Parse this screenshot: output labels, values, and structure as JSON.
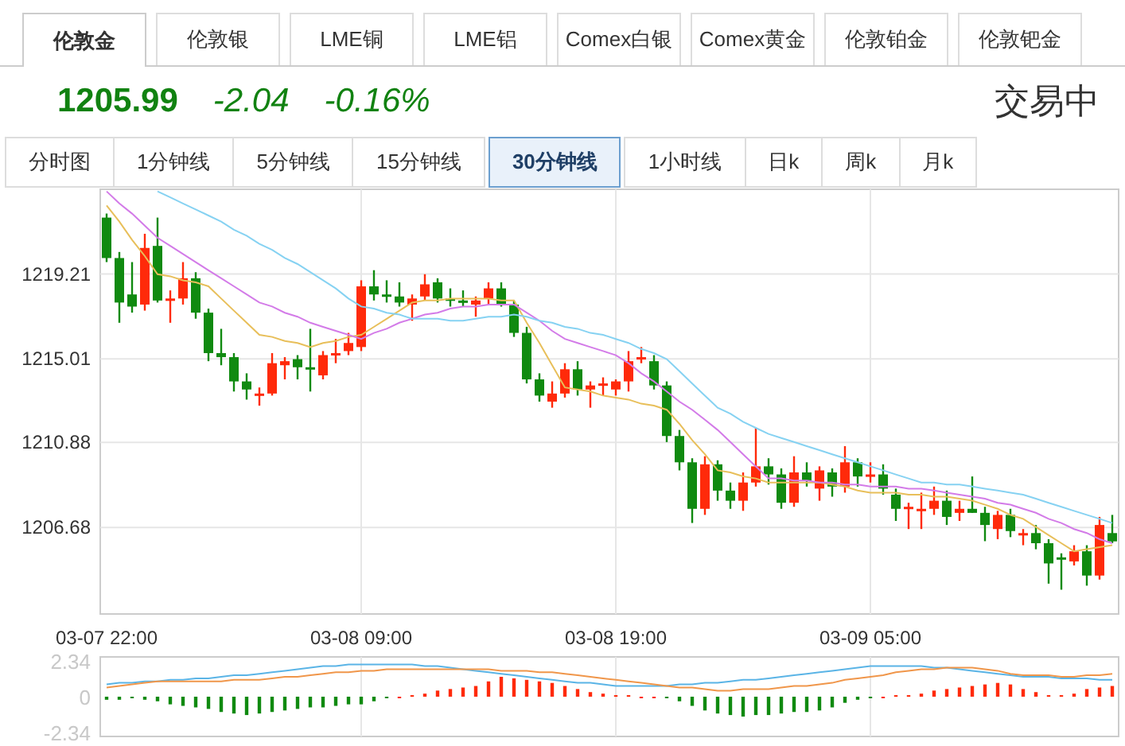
{
  "market_tabs": [
    {
      "label": "伦敦金",
      "selected": true
    },
    {
      "label": "伦敦银",
      "selected": false
    },
    {
      "label": "LME铜",
      "selected": false
    },
    {
      "label": "LME铝",
      "selected": false
    },
    {
      "label": "Comex白银",
      "selected": false
    },
    {
      "label": "Comex黄金",
      "selected": false
    },
    {
      "label": "伦敦铂金",
      "selected": false
    },
    {
      "label": "伦敦钯金",
      "selected": false
    }
  ],
  "quote": {
    "price": "1205.99",
    "change": "-2.04",
    "change_percent": "-0.16%",
    "status": "交易中"
  },
  "period_tabs": [
    {
      "label": "分时图",
      "selected": false
    },
    {
      "label": "1分钟线",
      "selected": false
    },
    {
      "label": "5分钟线",
      "selected": false
    },
    {
      "label": "15分钟线",
      "selected": false
    },
    {
      "label": "30分钟线",
      "selected": true
    },
    {
      "label": "1小时线",
      "selected": false
    },
    {
      "label": "日k",
      "selected": false
    },
    {
      "label": "周k",
      "selected": false
    },
    {
      "label": "月k",
      "selected": false
    }
  ],
  "price_chart": {
    "chart_data": {
      "type": "candlestick",
      "grid": true,
      "ylim": [
        1202.4,
        1223.4
      ],
      "yticks": [
        1206.68,
        1210.88,
        1215.01,
        1219.21
      ],
      "categories": [
        "03-07 22:00",
        null,
        null,
        null,
        null,
        null,
        null,
        null,
        null,
        null,
        null,
        null,
        null,
        null,
        null,
        null,
        null,
        null,
        null,
        null,
        "03-08 09:00",
        null,
        null,
        null,
        null,
        null,
        null,
        null,
        null,
        null,
        null,
        null,
        null,
        null,
        null,
        null,
        null,
        null,
        null,
        null,
        "03-08 19:00",
        null,
        null,
        null,
        null,
        null,
        null,
        null,
        null,
        null,
        null,
        null,
        null,
        null,
        null,
        null,
        null,
        null,
        null,
        null,
        "03-09 05:00",
        null,
        null,
        null,
        null,
        null,
        null,
        null,
        null,
        null,
        null,
        null,
        null,
        null,
        null,
        null,
        null,
        null,
        null,
        null
      ],
      "ohlc": [
        [
          1222.0,
          1222.2,
          1219.8,
          1220.0
        ],
        [
          1220.0,
          1220.3,
          1216.8,
          1217.8
        ],
        [
          1218.2,
          1219.8,
          1217.3,
          1217.6
        ],
        [
          1217.7,
          1221.2,
          1217.4,
          1220.5
        ],
        [
          1220.6,
          1222.0,
          1217.8,
          1217.9
        ],
        [
          1217.9,
          1218.4,
          1216.8,
          1218.0
        ],
        [
          1218.0,
          1219.8,
          1217.7,
          1219.0
        ],
        [
          1219.0,
          1219.3,
          1217.0,
          1217.3
        ],
        [
          1217.3,
          1217.5,
          1214.9,
          1215.3
        ],
        [
          1215.3,
          1216.5,
          1214.7,
          1215.1
        ],
        [
          1215.1,
          1215.3,
          1213.4,
          1213.9
        ],
        [
          1213.9,
          1214.3,
          1213.0,
          1213.5
        ],
        [
          1213.2,
          1213.6,
          1212.7,
          1213.3
        ],
        [
          1213.3,
          1215.3,
          1213.2,
          1214.8
        ],
        [
          1214.7,
          1215.1,
          1214.0,
          1214.9
        ],
        [
          1215.0,
          1215.2,
          1214.0,
          1214.6
        ],
        [
          1214.6,
          1216.5,
          1213.4,
          1214.5
        ],
        [
          1214.2,
          1215.4,
          1214.0,
          1215.2
        ],
        [
          1215.3,
          1216.0,
          1214.8,
          1215.3
        ],
        [
          1215.4,
          1216.3,
          1215.2,
          1215.8
        ],
        [
          1215.6,
          1218.9,
          1215.4,
          1218.6
        ],
        [
          1218.6,
          1219.4,
          1217.9,
          1218.2
        ],
        [
          1218.2,
          1218.9,
          1217.8,
          1218.1
        ],
        [
          1218.1,
          1218.8,
          1217.6,
          1217.8
        ],
        [
          1217.7,
          1218.2,
          1216.9,
          1218.0
        ],
        [
          1218.1,
          1219.2,
          1217.9,
          1218.7
        ],
        [
          1218.8,
          1219.0,
          1217.8,
          1218.0
        ],
        [
          1218.0,
          1218.5,
          1217.6,
          1217.9
        ],
        [
          1217.9,
          1218.4,
          1217.6,
          1217.8
        ],
        [
          1217.7,
          1218.1,
          1217.1,
          1217.9
        ],
        [
          1218.0,
          1218.8,
          1217.7,
          1218.5
        ],
        [
          1218.5,
          1218.8,
          1217.6,
          1217.7
        ],
        [
          1217.7,
          1217.9,
          1216.1,
          1216.3
        ],
        [
          1216.3,
          1216.6,
          1213.8,
          1214.0
        ],
        [
          1214.0,
          1214.3,
          1212.9,
          1213.2
        ],
        [
          1212.9,
          1213.9,
          1212.6,
          1213.3
        ],
        [
          1213.3,
          1214.8,
          1213.1,
          1214.5
        ],
        [
          1214.5,
          1214.9,
          1213.2,
          1213.5
        ],
        [
          1213.5,
          1213.9,
          1212.6,
          1213.7
        ],
        [
          1213.7,
          1214.1,
          1213.2,
          1213.8
        ],
        [
          1213.5,
          1214.0,
          1213.2,
          1213.9
        ],
        [
          1213.9,
          1215.4,
          1213.4,
          1214.9
        ],
        [
          1215.0,
          1215.6,
          1214.8,
          1215.1
        ],
        [
          1214.9,
          1215.2,
          1213.5,
          1213.7
        ],
        [
          1213.7,
          1213.9,
          1210.9,
          1211.2
        ],
        [
          1211.2,
          1211.5,
          1209.5,
          1209.9
        ],
        [
          1209.9,
          1210.1,
          1206.9,
          1207.6
        ],
        [
          1207.6,
          1210.2,
          1207.3,
          1209.8
        ],
        [
          1209.8,
          1210.0,
          1208.0,
          1208.5
        ],
        [
          1208.5,
          1208.9,
          1207.6,
          1208.0
        ],
        [
          1208.0,
          1209.4,
          1207.5,
          1208.9
        ],
        [
          1208.9,
          1211.6,
          1208.7,
          1209.7
        ],
        [
          1209.7,
          1210.1,
          1208.8,
          1209.3
        ],
        [
          1209.3,
          1209.6,
          1207.6,
          1207.9
        ],
        [
          1207.9,
          1210.2,
          1207.7,
          1209.4
        ],
        [
          1209.4,
          1209.9,
          1208.7,
          1209.0
        ],
        [
          1208.6,
          1209.7,
          1208.0,
          1209.5
        ],
        [
          1209.4,
          1209.6,
          1208.2,
          1208.7
        ],
        [
          1208.7,
          1210.7,
          1208.4,
          1209.9
        ],
        [
          1209.9,
          1210.1,
          1208.7,
          1209.2
        ],
        [
          1209.2,
          1209.9,
          1208.9,
          1209.3
        ],
        [
          1209.3,
          1209.8,
          1208.3,
          1208.6
        ],
        [
          1208.3,
          1208.6,
          1207.0,
          1207.6
        ],
        [
          1207.6,
          1207.9,
          1206.6,
          1207.7
        ],
        [
          1207.5,
          1208.4,
          1206.6,
          1207.6
        ],
        [
          1207.6,
          1208.7,
          1207.3,
          1208.0
        ],
        [
          1208.0,
          1208.5,
          1206.8,
          1207.2
        ],
        [
          1207.4,
          1208.0,
          1207.0,
          1207.6
        ],
        [
          1207.6,
          1209.2,
          1207.4,
          1207.4
        ],
        [
          1207.4,
          1207.7,
          1206.0,
          1206.8
        ],
        [
          1206.6,
          1207.5,
          1206.1,
          1207.3
        ],
        [
          1207.3,
          1207.6,
          1206.2,
          1206.5
        ],
        [
          1206.3,
          1206.6,
          1205.8,
          1206.4
        ],
        [
          1206.4,
          1206.8,
          1205.6,
          1205.9
        ],
        [
          1205.9,
          1206.1,
          1203.9,
          1204.9
        ],
        [
          1205.2,
          1205.4,
          1203.6,
          1205.1
        ],
        [
          1205.0,
          1205.8,
          1204.8,
          1205.5
        ],
        [
          1205.5,
          1205.8,
          1203.8,
          1204.3
        ],
        [
          1204.3,
          1207.2,
          1204.1,
          1206.8
        ],
        [
          1206.4,
          1207.3,
          1205.9,
          1205.99
        ]
      ],
      "series": [
        {
          "type": "line",
          "color": "#e8bf5a",
          "values": [
            1222.6,
            1221.8,
            1220.9,
            1220.1,
            1219.2,
            1219.1,
            1218.9,
            1218.8,
            1218.6,
            1218.0,
            1217.4,
            1216.8,
            1216.2,
            1216.1,
            1215.9,
            1215.8,
            1215.6,
            1215.8,
            1215.9,
            1216.1,
            1216.2,
            1216.6,
            1217.0,
            1217.4,
            1217.8,
            1217.9,
            1217.9,
            1218.0,
            1218.0,
            1218.0,
            1218.0,
            1217.9,
            1217.9,
            1216.8,
            1215.8,
            1214.7,
            1213.6,
            1213.5,
            1213.4,
            1213.2,
            1213.1,
            1213.0,
            1212.8,
            1212.7,
            1212.5,
            1211.8,
            1211.0,
            1210.3,
            1209.5,
            1209.4,
            1209.2,
            1209.1,
            1208.9,
            1208.9,
            1208.9,
            1208.9,
            1208.9,
            1208.8,
            1208.7,
            1208.5,
            1208.4,
            1208.4,
            1208.4,
            1208.3,
            1208.3,
            1208.2,
            1208.2,
            1208.1,
            1208.0,
            1207.8,
            1207.6,
            1207.3,
            1207.1,
            1206.7,
            1206.3,
            1205.9,
            1205.5,
            1205.6,
            1205.7,
            1205.8
          ]
        },
        {
          "type": "line",
          "color": "#d37be8",
          "values": [
            1223.3,
            1222.7,
            1222.2,
            1221.6,
            1221.0,
            1220.6,
            1220.2,
            1219.8,
            1219.4,
            1219.0,
            1218.6,
            1218.2,
            1217.8,
            1217.6,
            1217.3,
            1217.1,
            1216.8,
            1216.6,
            1216.4,
            1216.2,
            1216.0,
            1216.3,
            1216.5,
            1216.8,
            1217.0,
            1217.2,
            1217.3,
            1217.5,
            1217.6,
            1217.6,
            1217.7,
            1217.7,
            1217.7,
            1217.3,
            1216.9,
            1216.4,
            1216.0,
            1215.8,
            1215.6,
            1215.4,
            1215.2,
            1214.8,
            1214.3,
            1213.9,
            1213.4,
            1212.9,
            1212.5,
            1212.0,
            1211.5,
            1210.9,
            1210.3,
            1209.7,
            1209.1,
            1209.1,
            1209.0,
            1209.0,
            1208.9,
            1208.9,
            1208.8,
            1208.8,
            1208.7,
            1208.7,
            1208.7,
            1208.6,
            1208.6,
            1208.5,
            1208.4,
            1208.3,
            1208.2,
            1208.1,
            1207.9,
            1207.8,
            1207.6,
            1207.4,
            1207.1,
            1206.9,
            1206.6,
            1206.4,
            1206.1,
            1205.9
          ]
        },
        {
          "type": "line",
          "color": "#86d2f2",
          "values": [
            null,
            null,
            null,
            null,
            1223.3,
            1223.0,
            1222.7,
            1222.4,
            1222.1,
            1221.8,
            1221.4,
            1221.1,
            1220.7,
            1220.4,
            1220.0,
            1219.7,
            1219.3,
            1218.9,
            1218.5,
            1218.0,
            1217.6,
            1217.5,
            1217.3,
            1217.2,
            1217.0,
            1217.0,
            1217.0,
            1216.9,
            1216.9,
            1217.0,
            1217.1,
            1217.1,
            1217.2,
            1217.1,
            1216.9,
            1216.8,
            1216.6,
            1216.5,
            1216.3,
            1216.2,
            1216.0,
            1215.8,
            1215.5,
            1215.3,
            1215.0,
            1214.4,
            1213.8,
            1213.2,
            1212.6,
            1212.3,
            1211.9,
            1211.6,
            1211.3,
            1211.1,
            1210.9,
            1210.7,
            1210.5,
            1210.3,
            1210.1,
            1209.9,
            1209.7,
            1209.5,
            1209.3,
            1209.1,
            1208.9,
            1208.9,
            1208.8,
            1208.8,
            1208.7,
            1208.6,
            1208.5,
            1208.4,
            1208.3,
            1208.1,
            1207.9,
            1207.7,
            1207.5,
            1207.3,
            1207.1,
            1206.9
          ]
        }
      ]
    }
  },
  "macd_chart": {
    "chart_data": {
      "type": "bar",
      "grid": true,
      "ylim": [
        -2.6,
        2.6
      ],
      "yticks": [
        2.34,
        0,
        -2.34
      ],
      "categories": [
        null,
        null,
        null,
        null,
        null,
        null,
        null,
        null,
        null,
        null,
        null,
        null,
        null,
        null,
        null,
        null,
        null,
        null,
        null,
        null,
        null,
        null,
        null,
        null,
        null,
        null,
        null,
        null,
        null,
        null,
        null,
        null,
        null,
        null,
        null,
        null,
        null,
        null,
        null,
        null,
        null,
        null,
        null,
        null,
        null,
        null,
        null,
        null,
        null,
        null,
        null,
        null,
        null,
        null,
        null,
        null,
        null,
        null,
        null,
        null,
        null,
        null,
        null,
        null,
        null,
        null,
        null,
        null,
        null,
        null,
        null,
        null,
        null,
        null,
        null,
        null,
        null,
        null,
        null,
        null
      ],
      "series": [
        {
          "colors": [
            "#108a10",
            "#108a10",
            "#108a10",
            "#108a10",
            "#108a10",
            "#108a10",
            "#108a10",
            "#108a10",
            "#108a10",
            "#108a10",
            "#108a10",
            "#108a10",
            "#108a10",
            "#108a10",
            "#108a10",
            "#108a10",
            "#108a10",
            "#108a10",
            "#108a10",
            "#108a10",
            "#108a10",
            "#108a10",
            "#108a10",
            "#ff2a0a",
            "#ff2a0a",
            "#ff2a0a",
            "#ff2a0a",
            "#ff2a0a",
            "#ff2a0a",
            "#ff2a0a",
            "#ff2a0a",
            "#ff2a0a",
            "#ff2a0a",
            "#ff2a0a",
            "#ff2a0a",
            "#ff2a0a",
            "#ff2a0a",
            "#ff2a0a",
            "#ff2a0a",
            "#ff2a0a",
            "#ff2a0a",
            "#ff2a0a",
            "#ff2a0a",
            "#ff2a0a",
            "#108a10",
            "#108a10",
            "#108a10",
            "#108a10",
            "#108a10",
            "#108a10",
            "#108a10",
            "#108a10",
            "#108a10",
            "#108a10",
            "#108a10",
            "#108a10",
            "#108a10",
            "#108a10",
            "#108a10",
            "#108a10",
            "#108a10",
            "#ff2a0a",
            "#ff2a0a",
            "#ff2a0a",
            "#ff2a0a",
            "#ff2a0a",
            "#ff2a0a",
            "#ff2a0a",
            "#ff2a0a",
            "#ff2a0a",
            "#ff2a0a",
            "#ff2a0a",
            "#ff2a0a",
            "#ff2a0a",
            "#ff2a0a",
            "#ff2a0a",
            "#ff2a0a",
            "#ff2a0a",
            "#ff2a0a",
            "#ff2a0a"
          ],
          "values": [
            -0.2,
            -0.2,
            -0.1,
            -0.2,
            -0.3,
            -0.5,
            -0.6,
            -0.7,
            -0.8,
            -1.0,
            -1.1,
            -1.2,
            -1.1,
            -1.0,
            -0.9,
            -0.8,
            -0.7,
            -0.7,
            -0.6,
            -0.5,
            -0.5,
            -0.3,
            -0.1,
            0.0,
            0.1,
            0.2,
            0.4,
            0.5,
            0.6,
            0.7,
            1.0,
            1.3,
            1.2,
            1.1,
            1.0,
            0.9,
            0.7,
            0.5,
            0.3,
            0.2,
            0.1,
            0.1,
            0.0,
            0.0,
            -0.1,
            -0.3,
            -0.6,
            -0.9,
            -1.1,
            -1.2,
            -1.3,
            -1.2,
            -1.2,
            -1.1,
            -1.0,
            -1.0,
            -0.9,
            -0.7,
            -0.4,
            -0.2,
            -0.1,
            0.0,
            0.1,
            0.1,
            0.2,
            0.4,
            0.5,
            0.6,
            0.7,
            0.8,
            0.9,
            0.8,
            0.5,
            0.3,
            0.1,
            0.1,
            0.2,
            0.5,
            0.6,
            0.7
          ]
        },
        {
          "type": "line",
          "color": "#5ab4e6",
          "values": [
            0.8,
            0.9,
            0.9,
            1.0,
            1.0,
            1.1,
            1.1,
            1.2,
            1.2,
            1.3,
            1.4,
            1.4,
            1.5,
            1.6,
            1.7,
            1.8,
            1.9,
            2.0,
            2.0,
            2.1,
            2.1,
            2.1,
            2.1,
            2.1,
            2.1,
            2.0,
            2.0,
            1.9,
            1.8,
            1.7,
            1.6,
            1.5,
            1.4,
            1.3,
            1.2,
            1.1,
            1.0,
            0.9,
            0.9,
            0.8,
            0.7,
            0.7,
            0.7,
            0.7,
            0.7,
            0.8,
            0.8,
            0.9,
            0.9,
            1.0,
            1.1,
            1.1,
            1.2,
            1.3,
            1.4,
            1.5,
            1.6,
            1.7,
            1.8,
            1.9,
            2.0,
            2.0,
            2.0,
            2.0,
            2.0,
            1.9,
            1.9,
            1.8,
            1.7,
            1.6,
            1.5,
            1.4,
            1.3,
            1.3,
            1.3,
            1.2,
            1.2,
            1.2,
            1.1,
            1.1
          ]
        },
        {
          "type": "line",
          "color": "#f0964a",
          "values": [
            0.6,
            0.7,
            0.8,
            0.9,
            1.0,
            1.0,
            1.0,
            1.0,
            1.0,
            1.0,
            1.1,
            1.1,
            1.1,
            1.2,
            1.3,
            1.3,
            1.4,
            1.5,
            1.6,
            1.6,
            1.7,
            1.7,
            1.8,
            1.8,
            1.8,
            1.8,
            1.8,
            1.8,
            1.8,
            1.8,
            1.8,
            1.7,
            1.7,
            1.7,
            1.6,
            1.6,
            1.5,
            1.4,
            1.3,
            1.2,
            1.1,
            1.0,
            0.9,
            0.8,
            0.7,
            0.6,
            0.6,
            0.5,
            0.4,
            0.4,
            0.5,
            0.5,
            0.5,
            0.6,
            0.7,
            0.7,
            0.8,
            0.9,
            1.1,
            1.2,
            1.3,
            1.4,
            1.6,
            1.7,
            1.8,
            1.8,
            1.9,
            1.9,
            1.9,
            1.8,
            1.7,
            1.5,
            1.4,
            1.4,
            1.4,
            1.3,
            1.3,
            1.4,
            1.4,
            1.5
          ]
        }
      ]
    }
  }
}
